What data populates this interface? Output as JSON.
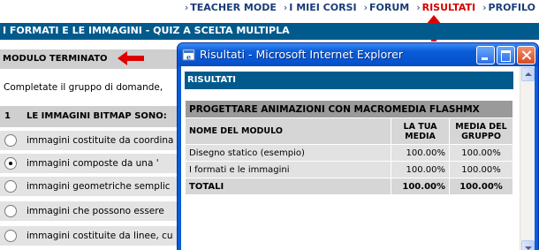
{
  "nav": {
    "items": [
      {
        "label": "TEACHER MODE"
      },
      {
        "label": "I MIEI CORSI"
      },
      {
        "label": "FORUM"
      },
      {
        "label": "RISULTATI"
      },
      {
        "label": "PROFILO"
      }
    ],
    "active_color": "#d40000",
    "link_color": "#1a3c78"
  },
  "page": {
    "title": "I FORMATI E LE IMMAGINI - QUIZ A SCELTA MULTIPLA",
    "module_status": "MODULO TERMINATO",
    "instructions": "Completate il gruppo di domande,",
    "question": {
      "number": "1",
      "text": "LE IMMAGINI BITMAP SONO:",
      "options": [
        {
          "text": "immagini costituite da coordina",
          "selected": false
        },
        {
          "text": "immagini composte da una '",
          "selected": true
        },
        {
          "text": "immagini geometriche semplic",
          "selected": false
        },
        {
          "text": "immagini che possono essere",
          "selected": false
        },
        {
          "text": "immagini costituite da linee, cu",
          "selected": false
        }
      ]
    },
    "header_color": "#005a8c"
  },
  "popup": {
    "title": "Risultati - Microsoft Internet Explorer",
    "section_label": "RISULTATI",
    "table": {
      "course": "PROGETTARE ANIMAZIONI CON MACROMEDIA FLASHMX",
      "headers": {
        "module": "NOME DEL MODULO",
        "yours_1": "LA TUA",
        "yours_2": "MEDIA",
        "group_1": "MEDIA DEL",
        "group_2": "GRUPPO"
      },
      "rows": [
        {
          "module": "Disegno statico (esempio)",
          "yours": "100.00%",
          "group": "100.00%"
        },
        {
          "module": "I formati e le immagini",
          "yours": "100.00%",
          "group": "100.00%"
        }
      ],
      "total": {
        "label": "TOTALI",
        "yours": "100.00%",
        "group": "100.00%"
      }
    }
  },
  "annotation_color": "#e00000"
}
